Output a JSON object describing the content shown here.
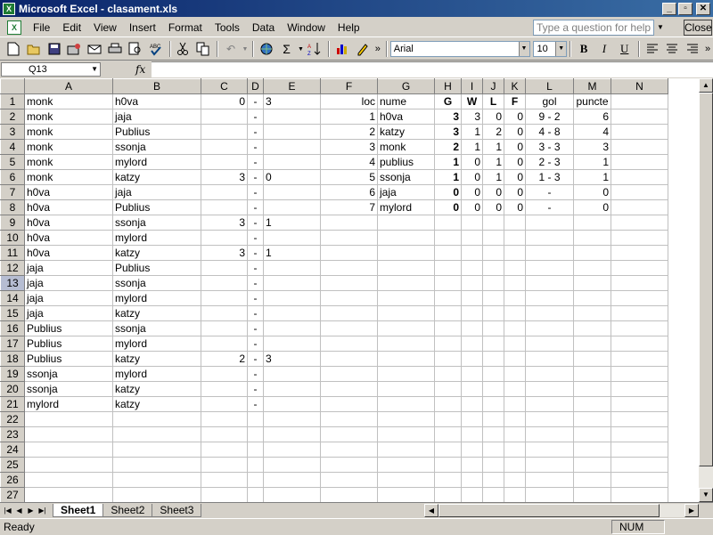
{
  "window": {
    "title": "Microsoft Excel - clasament.xls",
    "minimize": "_",
    "restore": "▫",
    "close": "✕"
  },
  "menu": {
    "items": [
      "File",
      "Edit",
      "View",
      "Insert",
      "Format",
      "Tools",
      "Data",
      "Window",
      "Help"
    ],
    "help_placeholder": "Type a question for help",
    "close_label": "Close"
  },
  "toolbar": {
    "font": "Arial",
    "size": "10",
    "bold": "B",
    "italic": "I",
    "underline": "U"
  },
  "formula": {
    "cell_ref": "Q13",
    "fx": "fx",
    "content": ""
  },
  "grid": {
    "columns": [
      "A",
      "B",
      "C",
      "D",
      "E",
      "F",
      "G",
      "H",
      "I",
      "J",
      "K",
      "L",
      "M",
      "N"
    ],
    "rows": [
      [
        "monk",
        "h0va",
        "0",
        "-",
        "3",
        "loc",
        "nume",
        "G",
        "W",
        "L",
        "F",
        "gol",
        "puncte",
        ""
      ],
      [
        "monk",
        "jaja",
        "",
        "-",
        "",
        "1",
        "h0va",
        "3",
        "3",
        "0",
        "0",
        "9 - 2",
        "6",
        ""
      ],
      [
        "monk",
        "Publius",
        "",
        "-",
        "",
        "2",
        "katzy",
        "3",
        "1",
        "2",
        "0",
        "4 - 8",
        "4",
        ""
      ],
      [
        "monk",
        "ssonja",
        "",
        "-",
        "",
        "3",
        "monk",
        "2",
        "1",
        "1",
        "0",
        "3 - 3",
        "3",
        ""
      ],
      [
        "monk",
        "mylord",
        "",
        "-",
        "",
        "4",
        "publius",
        "1",
        "0",
        "1",
        "0",
        "2 - 3",
        "1",
        ""
      ],
      [
        "monk",
        "katzy",
        "3",
        "-",
        "0",
        "5",
        "ssonja",
        "1",
        "0",
        "1",
        "0",
        "1 - 3",
        "1",
        ""
      ],
      [
        "h0va",
        "jaja",
        "",
        "-",
        "",
        "6",
        "jaja",
        "0",
        "0",
        "0",
        "0",
        "-",
        "0",
        ""
      ],
      [
        "h0va",
        "Publius",
        "",
        "-",
        "",
        "7",
        "mylord",
        "0",
        "0",
        "0",
        "0",
        "-",
        "0",
        ""
      ],
      [
        "h0va",
        "ssonja",
        "3",
        "-",
        "1",
        "",
        "",
        "",
        "",
        "",
        "",
        "",
        "",
        ""
      ],
      [
        "h0va",
        "mylord",
        "",
        "-",
        "",
        "",
        "",
        "",
        "",
        "",
        "",
        "",
        "",
        ""
      ],
      [
        "h0va",
        "katzy",
        "3",
        "-",
        "1",
        "",
        "",
        "",
        "",
        "",
        "",
        "",
        "",
        ""
      ],
      [
        "jaja",
        "Publius",
        "",
        "-",
        "",
        "",
        "",
        "",
        "",
        "",
        "",
        "",
        "",
        ""
      ],
      [
        "jaja",
        "ssonja",
        "",
        "-",
        "",
        "",
        "",
        "",
        "",
        "",
        "",
        "",
        "",
        ""
      ],
      [
        "jaja",
        "mylord",
        "",
        "-",
        "",
        "",
        "",
        "",
        "",
        "",
        "",
        "",
        "",
        ""
      ],
      [
        "jaja",
        "katzy",
        "",
        "-",
        "",
        "",
        "",
        "",
        "",
        "",
        "",
        "",
        "",
        ""
      ],
      [
        "Publius",
        "ssonja",
        "",
        "-",
        "",
        "",
        "",
        "",
        "",
        "",
        "",
        "",
        "",
        ""
      ],
      [
        "Publius",
        "mylord",
        "",
        "-",
        "",
        "",
        "",
        "",
        "",
        "",
        "",
        "",
        "",
        ""
      ],
      [
        "Publius",
        "katzy",
        "2",
        "-",
        "3",
        "",
        "",
        "",
        "",
        "",
        "",
        "",
        "",
        ""
      ],
      [
        "ssonja",
        "mylord",
        "",
        "-",
        "",
        "",
        "",
        "",
        "",
        "",
        "",
        "",
        "",
        ""
      ],
      [
        "ssonja",
        "katzy",
        "",
        "-",
        "",
        "",
        "",
        "",
        "",
        "",
        "",
        "",
        "",
        ""
      ],
      [
        "mylord",
        "katzy",
        "",
        "-",
        "",
        "",
        "",
        "",
        "",
        "",
        "",
        "",
        "",
        ""
      ],
      [
        "",
        "",
        "",
        "",
        "",
        "",
        "",
        "",
        "",
        "",
        "",
        "",
        "",
        ""
      ],
      [
        "",
        "",
        "",
        "",
        "",
        "",
        "",
        "",
        "",
        "",
        "",
        "",
        "",
        ""
      ],
      [
        "",
        "",
        "",
        "",
        "",
        "",
        "",
        "",
        "",
        "",
        "",
        "",
        "",
        ""
      ],
      [
        "",
        "",
        "",
        "",
        "",
        "",
        "",
        "",
        "",
        "",
        "",
        "",
        "",
        ""
      ],
      [
        "",
        "",
        "",
        "",
        "",
        "",
        "",
        "",
        "",
        "",
        "",
        "",
        "",
        ""
      ],
      [
        "",
        "",
        "",
        "",
        "",
        "",
        "",
        "",
        "",
        "",
        "",
        "",
        "",
        ""
      ]
    ],
    "selected_row": 13
  },
  "sheets": [
    "Sheet1",
    "Sheet2",
    "Sheet3"
  ],
  "active_sheet": "Sheet1",
  "status": {
    "text": "Ready",
    "num": "NUM"
  }
}
